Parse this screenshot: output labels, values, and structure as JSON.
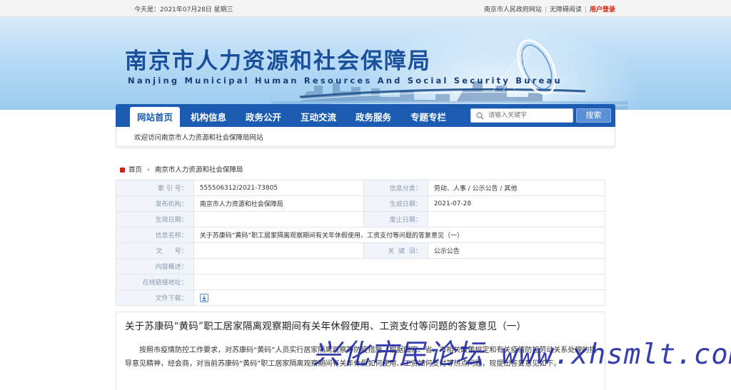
{
  "topbar": {
    "date": "今天是：2021年07月28日 星期三",
    "link_gov": "南京市人民政府网站",
    "link_accessible": "无障碍阅读",
    "link_login": "用户登录",
    "sep": "|"
  },
  "banner": {
    "title": "南京市人力资源和社会保障局",
    "subtitle": "Nanjing Municipal Human Resources And Social Security Bureau"
  },
  "nav": {
    "items": [
      "网站首页",
      "机构信息",
      "政务公开",
      "互动交流",
      "政务服务",
      "专题专栏"
    ],
    "search_placeholder": "请输入关键字",
    "search_button": "搜索"
  },
  "welcome": "欢迎访问南京市人力资源和社会保障局网站",
  "breadcrumb": {
    "home": "首页",
    "chevron": "›",
    "current": "南京市人力资源和社会保障局"
  },
  "info": {
    "index_label": "索  引  号：",
    "index_value": "555506312/2021-73805",
    "category_label": "信息分类：",
    "category_value": "劳动、人事 / 公示公告 / 其他",
    "publisher_label": "发布机构：",
    "publisher_value": "南京市人力资源和社会保障局",
    "generated_label": "生成日期：",
    "generated_value": "2021-07-28",
    "effective_label": "生效日期：",
    "effective_value": "",
    "expiry_label": "废止日期：",
    "expiry_value": "",
    "name_label": "信息名称：",
    "name_value": "关于苏康码“黄码”职工居家隔离观察期间有关年休假使用、工资支付等问题的答复意见（一）",
    "docno_label": "文      号：",
    "docno_value": "",
    "keyword_label": "关  键  词：",
    "keyword_value": "公示公告",
    "overview_label": "内容概述：",
    "overview_value": "",
    "online_label": "在线链接地址：",
    "online_value": "",
    "download_label": "文件下载："
  },
  "article": {
    "title": "关于苏康码“黄码”职工居家隔离观察期间有关年休假使用、工资支付等问题的答复意见（一）",
    "body": "按照市疫情防控工作要求，对苏康码“黄码”人员实行居家隔离观察等防疫措施。根据国家、省、市相关政策规定和有关疫情防控劳动关系处理的指导意见精神，经会商，对当前苏康码“黄码”职工居家隔离观察期间有关年休假如何使用、工资如何支付等热点问题，现提出答复意见如下。"
  },
  "watermark": "兴化市民论坛 www.xhsmlt.com",
  "colors": {
    "nav_blue": "#1b5cb2",
    "title_blue": "#1a4f9c",
    "login_red": "#d81e06"
  }
}
